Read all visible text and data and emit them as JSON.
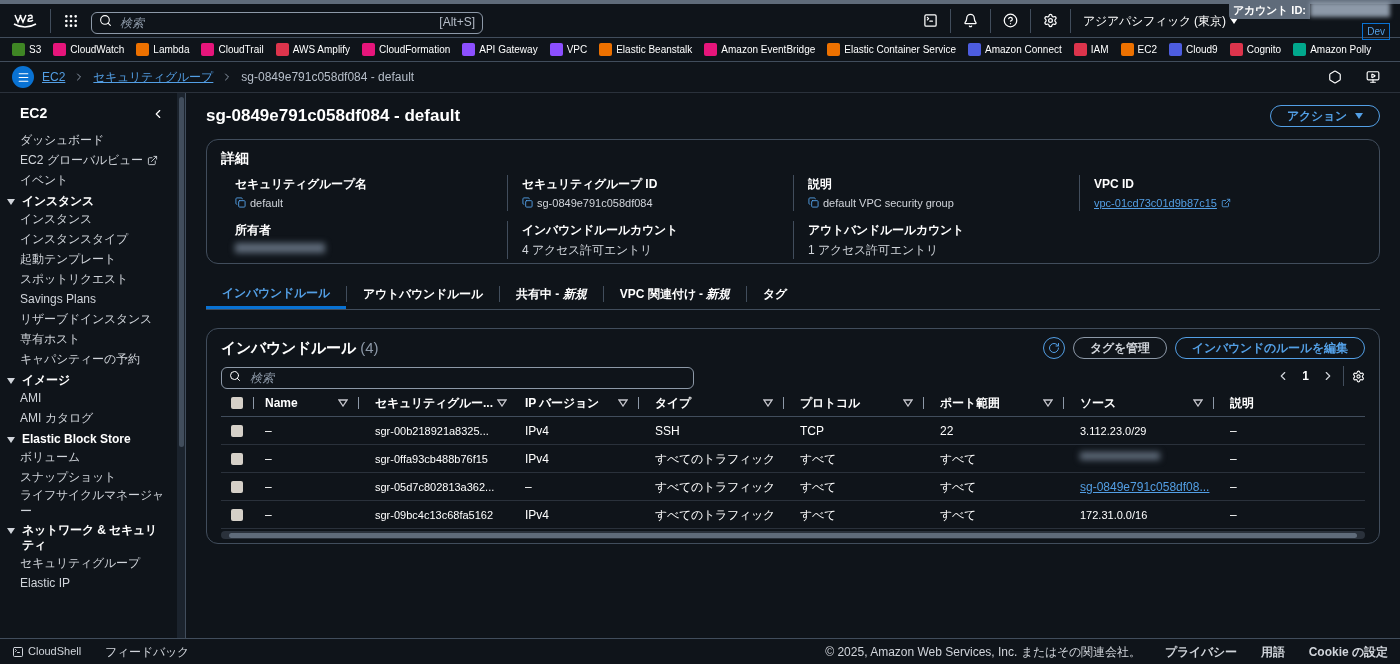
{
  "top_bar": {
    "search": {
      "placeholder": "検索",
      "shortcut": "[Alt+S]"
    },
    "region": "アジアパシフィック (東京)",
    "account_label": "アカウント ID:",
    "account_badge": "Dev"
  },
  "favorites": [
    {
      "label": "S3",
      "color": "#3f8624"
    },
    {
      "label": "CloudWatch",
      "color": "#e7157b"
    },
    {
      "label": "Lambda",
      "color": "#ed7100"
    },
    {
      "label": "CloudTrail",
      "color": "#e7157b"
    },
    {
      "label": "AWS Amplify",
      "color": "#dd344c"
    },
    {
      "label": "CloudFormation",
      "color": "#e7157b"
    },
    {
      "label": "API Gateway",
      "color": "#8c4fff"
    },
    {
      "label": "VPC",
      "color": "#8c4fff"
    },
    {
      "label": "Elastic Beanstalk",
      "color": "#ed7100"
    },
    {
      "label": "Amazon EventBridge",
      "color": "#e7157b"
    },
    {
      "label": "Elastic Container Service",
      "color": "#ed7100"
    },
    {
      "label": "Amazon Connect",
      "color": "#4d5de0"
    },
    {
      "label": "IAM",
      "color": "#dd344c"
    },
    {
      "label": "EC2",
      "color": "#ed7100"
    },
    {
      "label": "Cloud9",
      "color": "#4d5de0"
    },
    {
      "label": "Cognito",
      "color": "#dd344c"
    },
    {
      "label": "Amazon Polly",
      "color": "#01a88d"
    }
  ],
  "breadcrumbs": [
    "EC2",
    "セキュリティグループ",
    "sg-0849e791c058df084 - default"
  ],
  "sidebar": {
    "title": "EC2",
    "items": [
      {
        "label": "ダッシュボード",
        "external": false
      },
      {
        "label": "EC2 グローバルビュー",
        "external": true
      },
      {
        "label": "イベント",
        "external": false
      }
    ],
    "sections": [
      {
        "title": "インスタンス",
        "expanded": true,
        "items": [
          "インスタンス",
          "インスタンスタイプ",
          "起動テンプレート",
          "スポットリクエスト",
          "Savings Plans",
          "リザーブドインスタンス",
          "専有ホスト",
          "キャパシティーの予約"
        ]
      },
      {
        "title": "イメージ",
        "expanded": true,
        "items": [
          "AMI",
          "AMI カタログ"
        ]
      },
      {
        "title": "Elastic Block Store",
        "expanded": true,
        "items": [
          "ボリューム",
          "スナップショット",
          "ライフサイクルマネージャー"
        ]
      },
      {
        "title": "ネットワーク & セキュリティ",
        "expanded": true,
        "items": [
          "セキュリティグループ",
          "Elastic IP"
        ]
      }
    ]
  },
  "page": {
    "title": "sg-0849e791c058df084 - default",
    "actions_button": "アクション"
  },
  "details": {
    "title": "詳細",
    "fields": [
      {
        "label": "セキュリティグループ名",
        "value": "default",
        "kind": "copy"
      },
      {
        "label": "セキュリティグループ ID",
        "value": "sg-0849e791c058df084",
        "kind": "copy"
      },
      {
        "label": "説明",
        "value": "default VPC security group",
        "kind": "copy"
      },
      {
        "label": "VPC ID",
        "value": "vpc-01cd73c01d9b87c15",
        "kind": "link"
      },
      {
        "label": "所有者",
        "kind": "redacted"
      },
      {
        "label": "インバウンドルールカウント",
        "value": "4 アクセス許可エントリ",
        "kind": "text"
      },
      {
        "label": "アウトバンドルールカウント",
        "value": "1 アクセス許可エントリ",
        "kind": "text"
      }
    ]
  },
  "tabs": [
    {
      "label": "インバウンドルール",
      "selected": true
    },
    {
      "label": "アウトバウンドルール",
      "selected": false
    },
    {
      "label": "共有中 - *新規*",
      "selected": false
    },
    {
      "label": "VPC 関連付け - *新規*",
      "selected": false
    },
    {
      "label": "タグ",
      "selected": false
    }
  ],
  "rules_table": {
    "title": "インバウンドルール",
    "count": "(4)",
    "manage_tags_button": "タグを管理",
    "edit_button": "インバウンドのルールを編集",
    "search_placeholder": "検索",
    "page": "1",
    "all_checked": false,
    "columns": [
      "Name",
      "セキュリティグルー...",
      "IP バージョン",
      "タイプ",
      "プロトコル",
      "ポート範囲",
      "ソース",
      "説明"
    ],
    "rows": [
      {
        "checked": false,
        "name": "–",
        "rule_id": "sgr-00b218921a8325...",
        "ip_version": "IPv4",
        "type": "SSH",
        "protocol": "TCP",
        "port_range": "22",
        "source": "3.112.23.0/29",
        "source_link": false,
        "source_redacted": false,
        "description": "–"
      },
      {
        "checked": false,
        "name": "–",
        "rule_id": "sgr-0ffa93cb488b76f15",
        "ip_version": "IPv4",
        "type": "すべてのトラフィック",
        "protocol": "すべて",
        "port_range": "すべて",
        "source_redacted": true,
        "description": "–"
      },
      {
        "checked": false,
        "name": "–",
        "rule_id": "sgr-05d7c802813a362...",
        "ip_version": "–",
        "type": "すべてのトラフィック",
        "protocol": "すべて",
        "port_range": "すべて",
        "source": "sg-0849e791c058df08...",
        "source_link": true,
        "source_redacted": false,
        "description": "–"
      },
      {
        "checked": false,
        "name": "–",
        "rule_id": "sgr-09bc4c13c68fa5162",
        "ip_version": "IPv4",
        "type": "すべてのトラフィック",
        "protocol": "すべて",
        "port_range": "すべて",
        "source": "172.31.0.0/16",
        "source_link": false,
        "source_redacted": false,
        "description": "–"
      }
    ]
  },
  "footer": {
    "cloudshell": "CloudShell",
    "feedback": "フィードバック",
    "copyright": "© 2025, Amazon Web Services, Inc. またはその関連会社。",
    "links": [
      "プライバシー",
      "用語",
      "Cookie の設定"
    ]
  }
}
